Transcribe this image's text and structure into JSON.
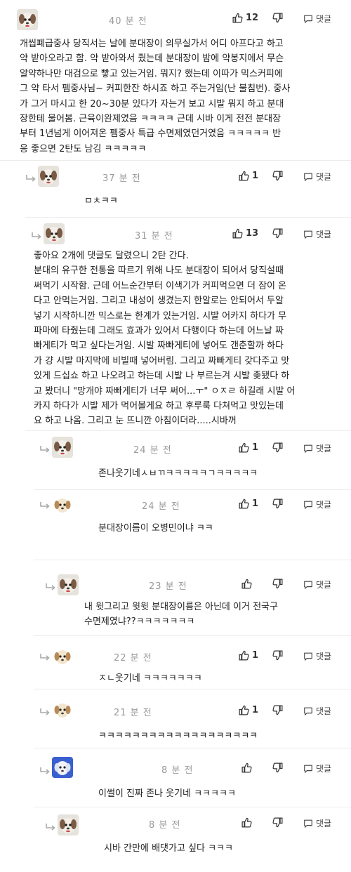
{
  "comments": [
    {
      "id": "c0",
      "time": "40 분 전",
      "likes": "12",
      "reply_label": "댓글",
      "text": "개씹폐급중사 당직서는 날에 분대장이 의무실가서 어디 아프다고 하고\n약 받아오라고 함. 약 받아와서 줬는데 분대장이 밤에 약봉지에서 무슨\n알약하나만 대검으로 빻고 있는거임. 뭐지? 했는데 이따가 믹스커피에\n그 약 타서 펨중사님~ 커피한잔 하시죠 하고 주는거임(난 불침번). 중사\n가 그거 마시고 한 20~30분 있다가 자는거 보고 시발 뭐지 하고 분대\n장한테 물어봄. 근육이완제였음 ㅋㅋㅋㅋ 근데 시바 이게 전전 분대장\n부터 1년넘게 이어져온 펨중사 특급 수면제였던거였음 ㅋㅋㅋㅋㅋ 반\n응 좋으면 2탄도 남김 ㅋㅋㅋㅋㅋ"
    },
    {
      "id": "c1",
      "time": "37 분 전",
      "likes": "1",
      "reply_label": "댓글",
      "text": "ㅁㅊㅋㅋ"
    },
    {
      "id": "c2",
      "time": "31 분 전",
      "likes": "13",
      "reply_label": "댓글",
      "text": "좋아요 2개에 댓글도 달렸으니 2탄 간다.\n분대의 유구한 전통을 따르기 위해 나도 분대장이 되어서 당직설때\n써먹기 시작함. 근데 어느순간부터 이색기가 커피먹으면 더 잠이 온\n다고 안먹는거임. 그리고 내성이 생겼는지 한알로는 안되어서 두알\n넣기 시작하니깐 믹스로는 한계가 있는거임. 시발 어카지 하다가 무\n파마에 타줬는데 그래도 효과가 있어서 다행이다 하는데 어느날 짜\n빠게티가 먹고 싶다는거임. 시발 짜빠게티에 넣어도 갠춘할까 하다\n가 걍 시발 마지막에 비빌때 넣어버림. 그리고 짜빠게티 갖다주고 맛\n있게 드십쇼 하고 나오려고 하는데 시발 나 부르는겨 시발 좆됐다 하\n고 봤더니 \"망개야 짜빠게티가 너무 써어...ㅜ\" ㅇㅈㄹ 하길래 시발 어\n카지 하다가 시발 제가 먹어볼게요 하고 후루룩 다쳐먹고 맛있는데\n요 하고 나옴. 그리고 눈 뜨니깐 아침이더라.....시바꺼"
    },
    {
      "id": "c3",
      "time": "24 분 전",
      "likes": "1",
      "reply_label": "댓글",
      "text": "존나웃기네ㅅㅂㄲㅋㅋㅋㅋㅋㄱㅋㅋㅋㅋㅋ"
    },
    {
      "id": "c4",
      "time": "24 분 전",
      "likes": "1",
      "reply_label": "댓글",
      "text": "분대장이름이 오병민이냐 ㅋㅋ"
    },
    {
      "id": "c5",
      "time": "23 분 전",
      "likes": "",
      "reply_label": "댓글",
      "text": "내 윗그리고 윗윗 분대장이름은 아닌데 이거 전국구\n수면제였냐??ㅋㅋㅋㅋㅋㅋㅋ"
    },
    {
      "id": "c6",
      "time": "22 분 전",
      "likes": "1",
      "reply_label": "댓글",
      "text": "ㅈㄴ웃기네 ㅋㅋㅋㅋㅋㅋㅋ"
    },
    {
      "id": "c7",
      "time": "21 분 전",
      "likes": "1",
      "reply_label": "댓글",
      "text": "ㅋㅋㅋㅋㅋㅋㅋㅋㅋㅋㅋㅋㅋㅋㅋㅋㅋㅋㅋ"
    },
    {
      "id": "c8",
      "time": "8 분 전",
      "likes": "",
      "reply_label": "댓글",
      "text": "이썰이 진짜 존나 웃기네 ㅋㅋㅋㅋㅋ"
    },
    {
      "id": "c9",
      "time": "8 분 전",
      "likes": "",
      "reply_label": "댓글",
      "text": "시바 간만에 배댓가고 싶다 ㅋㅋㅋ"
    }
  ],
  "icons": {
    "like": "thumbs-up-icon",
    "dislike": "thumbs-down-icon",
    "reply": "speech-bubble-icon",
    "reply_arrow": "reply-arrow-icon"
  },
  "colors": {
    "time": "#9a9a9a",
    "avatar_bg": "#e6e2dc",
    "avatar_blue": "#3a5fd0",
    "divider": "#ececec"
  }
}
